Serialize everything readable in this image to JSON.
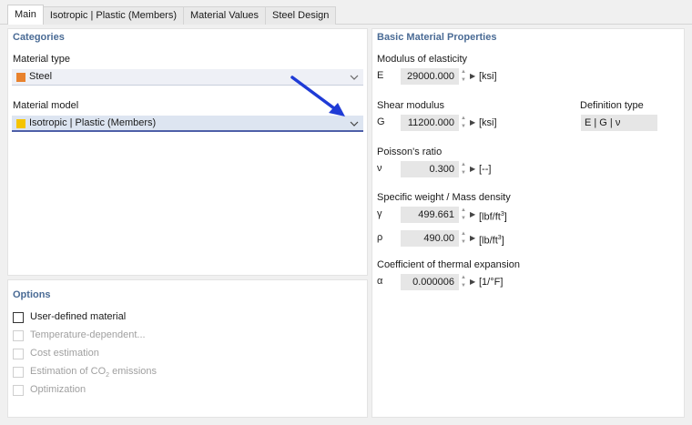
{
  "tabs": [
    {
      "label": "Main",
      "active": true
    },
    {
      "label": "Isotropic | Plastic (Members)",
      "active": false
    },
    {
      "label": "Material Values",
      "active": false
    },
    {
      "label": "Steel Design",
      "active": false
    }
  ],
  "categories": {
    "title": "Categories",
    "material_type": {
      "label": "Material type",
      "value": "Steel",
      "color": "#e8822e"
    },
    "material_model": {
      "label": "Material model",
      "value": "Isotropic | Plastic (Members)",
      "color": "#f5c400"
    }
  },
  "options": {
    "title": "Options",
    "items": [
      {
        "label": "User-defined material",
        "checked": false,
        "enabled": true
      },
      {
        "label": "Temperature-dependent...",
        "checked": false,
        "enabled": false
      },
      {
        "label": "Cost estimation",
        "checked": false,
        "enabled": false
      },
      {
        "label": "Estimation of CO",
        "sub": "2",
        "suffix": " emissions",
        "checked": false,
        "enabled": false
      },
      {
        "label": "Optimization",
        "checked": false,
        "enabled": false
      }
    ]
  },
  "properties": {
    "title": "Basic Material Properties",
    "modulus": {
      "label": "Modulus of elasticity",
      "symbol": "E",
      "value": "29000.000",
      "unit": "[ksi]"
    },
    "shear": {
      "label": "Shear modulus",
      "symbol": "G",
      "value": "11200.000",
      "unit": "[ksi]"
    },
    "definition_type": {
      "label": "Definition type",
      "value": "E | G | ν"
    },
    "poisson": {
      "label": "Poisson's ratio",
      "symbol": "ν",
      "value": "0.300",
      "unit": "[--]"
    },
    "weight_density": {
      "label": "Specific weight / Mass density",
      "gamma": {
        "symbol": "γ",
        "value": "499.661",
        "unit": "[lbf/ft",
        "unit_sup": "3",
        "unit_end": "]"
      },
      "rho": {
        "symbol": "ρ",
        "value": "490.00",
        "unit": "[lb/ft",
        "unit_sup": "3",
        "unit_end": "]"
      }
    },
    "thermal": {
      "label": "Coefficient of thermal expansion",
      "symbol": "α",
      "value": "0.000006",
      "unit": "[1/°F]"
    }
  },
  "colors": {
    "accent": "#4a6b95",
    "annotation_arrow": "#1f3bd6"
  }
}
